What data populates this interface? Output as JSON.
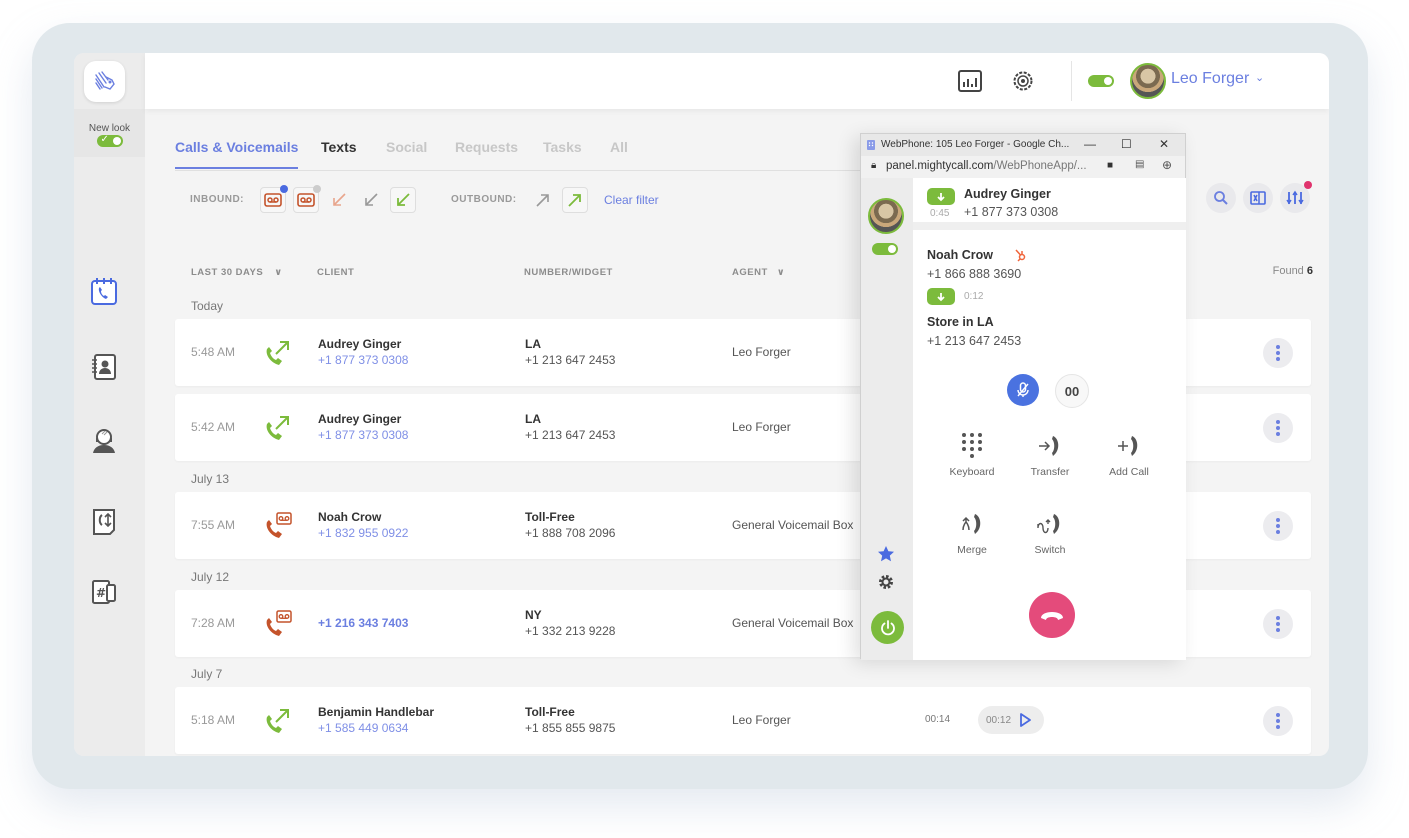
{
  "sidebar": {
    "new_look_label": "New look",
    "new_look_enabled": true,
    "items": [
      {
        "name": "calls",
        "icon": "calendar-phone-icon",
        "active": true
      },
      {
        "name": "contacts",
        "icon": "address-book-icon",
        "active": false
      },
      {
        "name": "agents",
        "icon": "headset-agent-icon",
        "active": false
      },
      {
        "name": "call-flows",
        "icon": "call-routing-icon",
        "active": false
      },
      {
        "name": "numbers",
        "icon": "numbers-devices-icon",
        "active": false
      }
    ]
  },
  "header": {
    "user_name": "Leo Forger",
    "status_enabled": true,
    "icons": [
      "reports-icon",
      "settings-icon",
      "dialpad-icon"
    ]
  },
  "tabs": [
    {
      "label": "Calls & Voicemails",
      "state": "active"
    },
    {
      "label": "Texts",
      "state": "normal"
    },
    {
      "label": "Social",
      "state": "disabled"
    },
    {
      "label": "Requests",
      "state": "disabled"
    },
    {
      "label": "Tasks",
      "state": "disabled"
    },
    {
      "label": "All",
      "state": "disabled"
    }
  ],
  "filters": {
    "inbound_label": "INBOUND:",
    "outbound_label": "OUTBOUND:",
    "clear_label": "Clear filter"
  },
  "table": {
    "columns": {
      "period": "LAST 30 DAYS",
      "client": "CLIENT",
      "number": "NUMBER/WIDGET",
      "agent": "AGENT"
    },
    "found_label": "Found",
    "found_count": "6",
    "groups": [
      {
        "label": "Today"
      },
      {
        "label": "July 13"
      },
      {
        "label": "July 12"
      },
      {
        "label": "July 7"
      }
    ],
    "rows": [
      {
        "time": "5:48 AM",
        "type": "outbound-call",
        "client_name": "Audrey Ginger",
        "client_phone": "+1 877 373 0308",
        "widget": "LA",
        "widget_phone": "+1 213 647 2453",
        "agent": "Leo Forger"
      },
      {
        "time": "5:42 AM",
        "type": "outbound-call",
        "client_name": "Audrey Ginger",
        "client_phone": "+1 877 373 0308",
        "widget": "LA",
        "widget_phone": "+1 213 647 2453",
        "agent": "Leo Forger"
      },
      {
        "time": "7:55 AM",
        "type": "voicemail",
        "client_name": "Noah Crow",
        "client_phone": "+1 832 955 0922",
        "widget": "Toll-Free",
        "widget_phone": "+1 888 708 2096",
        "agent": "General Voicemail Box"
      },
      {
        "time": "7:28 AM",
        "type": "voicemail",
        "client_name": "",
        "client_phone": "+1 216 343 7403",
        "widget": "NY",
        "widget_phone": "+1 332 213 9228",
        "agent": "General Voicemail Box"
      },
      {
        "time": "5:18 AM",
        "type": "outbound-call",
        "client_name": "Benjamin Handlebar",
        "client_phone": "+1 585 449 0634",
        "widget": "Toll-Free",
        "widget_phone": "+1 855 855 9875",
        "agent": "Leo Forger",
        "duration": "00:14",
        "recording": "00:12"
      }
    ]
  },
  "webphone": {
    "window_title": "WebPhone: 105 Leo Forger - Google Ch...",
    "url_host": "panel.mightycall.com",
    "url_path": "/WebPhoneApp/...",
    "active_call": {
      "name": "Audrey Ginger",
      "phone": "+1 877 373 0308",
      "timer": "0:45"
    },
    "current_call": {
      "name": "Noah Crow",
      "phone": "+1 866 888 3690",
      "timer": "0:12",
      "line_name": "Store in LA",
      "line_phone": "+1 213 647 2453"
    },
    "actions": [
      {
        "label": "Keyboard",
        "icon": "keypad-icon"
      },
      {
        "label": "Transfer",
        "icon": "transfer-icon"
      },
      {
        "label": "Add Call",
        "icon": "add-call-icon"
      },
      {
        "label": "Merge",
        "icon": "merge-icon"
      },
      {
        "label": "Switch",
        "icon": "switch-icon"
      }
    ],
    "hold_label": "00"
  },
  "colors": {
    "accent": "#6b7fe0",
    "green": "#7cbb3c",
    "voicemail": "#c4532b",
    "hangup": "#e44b7b"
  }
}
